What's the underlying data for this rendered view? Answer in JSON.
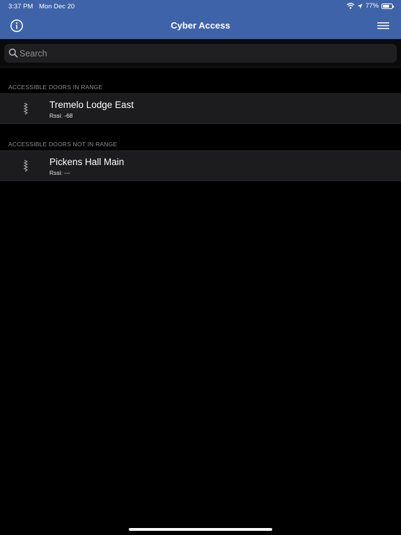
{
  "status_bar": {
    "time": "3:37 PM",
    "date": "Mon Dec 20",
    "battery": "77%",
    "battery_level": 0.77,
    "icons": [
      "wifi-icon",
      "location-arrow-icon",
      "battery-icon"
    ]
  },
  "nav": {
    "title": "Cyber Access",
    "left_icon": "info-icon",
    "right_icon": "hamburger-menu-icon"
  },
  "search": {
    "placeholder": "Search",
    "value": "",
    "icon": "search-icon"
  },
  "sections": [
    {
      "header": "ACCESSIBLE DOORS IN RANGE",
      "items": [
        {
          "title": "Tremelo Lodge East",
          "subtitle": "Rssi:  -68",
          "icon": "door-lock-icon"
        }
      ]
    },
    {
      "header": "ACCESSIBLE DOORS NOT IN RANGE",
      "items": [
        {
          "title": "Pickens Hall Main",
          "subtitle": "Rssi:  ---",
          "icon": "door-lock-icon"
        }
      ]
    }
  ],
  "colors": {
    "nav_background": "#3e63a8",
    "background": "#000000",
    "row_background": "#1c1c1e",
    "section_header_text": "#8e8e93"
  }
}
